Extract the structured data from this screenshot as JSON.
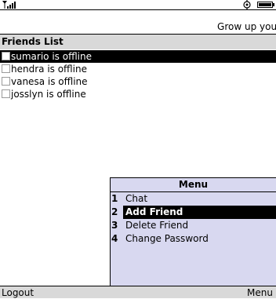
{
  "status_bar": {
    "signal_icon": "signal-strength-icon",
    "status_icon": "settings-icon",
    "battery_icon": "battery-icon"
  },
  "ticker": {
    "text": "Grow up your"
  },
  "page": {
    "title": "Friends List"
  },
  "friends": [
    {
      "label": "sumario is offline",
      "selected": true
    },
    {
      "label": "hendra is offline",
      "selected": false
    },
    {
      "label": "vanesa is offline",
      "selected": false
    },
    {
      "label": "josslyn is offline",
      "selected": false
    }
  ],
  "menu": {
    "title": "Menu",
    "items": [
      {
        "number": "1",
        "label": "Chat",
        "selected": false
      },
      {
        "number": "2",
        "label": "Add Friend",
        "selected": true
      },
      {
        "number": "3",
        "label": "Delete Friend",
        "selected": false
      },
      {
        "number": "4",
        "label": "Change Password",
        "selected": false
      }
    ]
  },
  "softkeys": {
    "left": "Logout",
    "right": "Menu"
  },
  "colors": {
    "title_bar": "#d9d9d9",
    "menu_background": "#d8d8f0",
    "selection": "#000000"
  }
}
